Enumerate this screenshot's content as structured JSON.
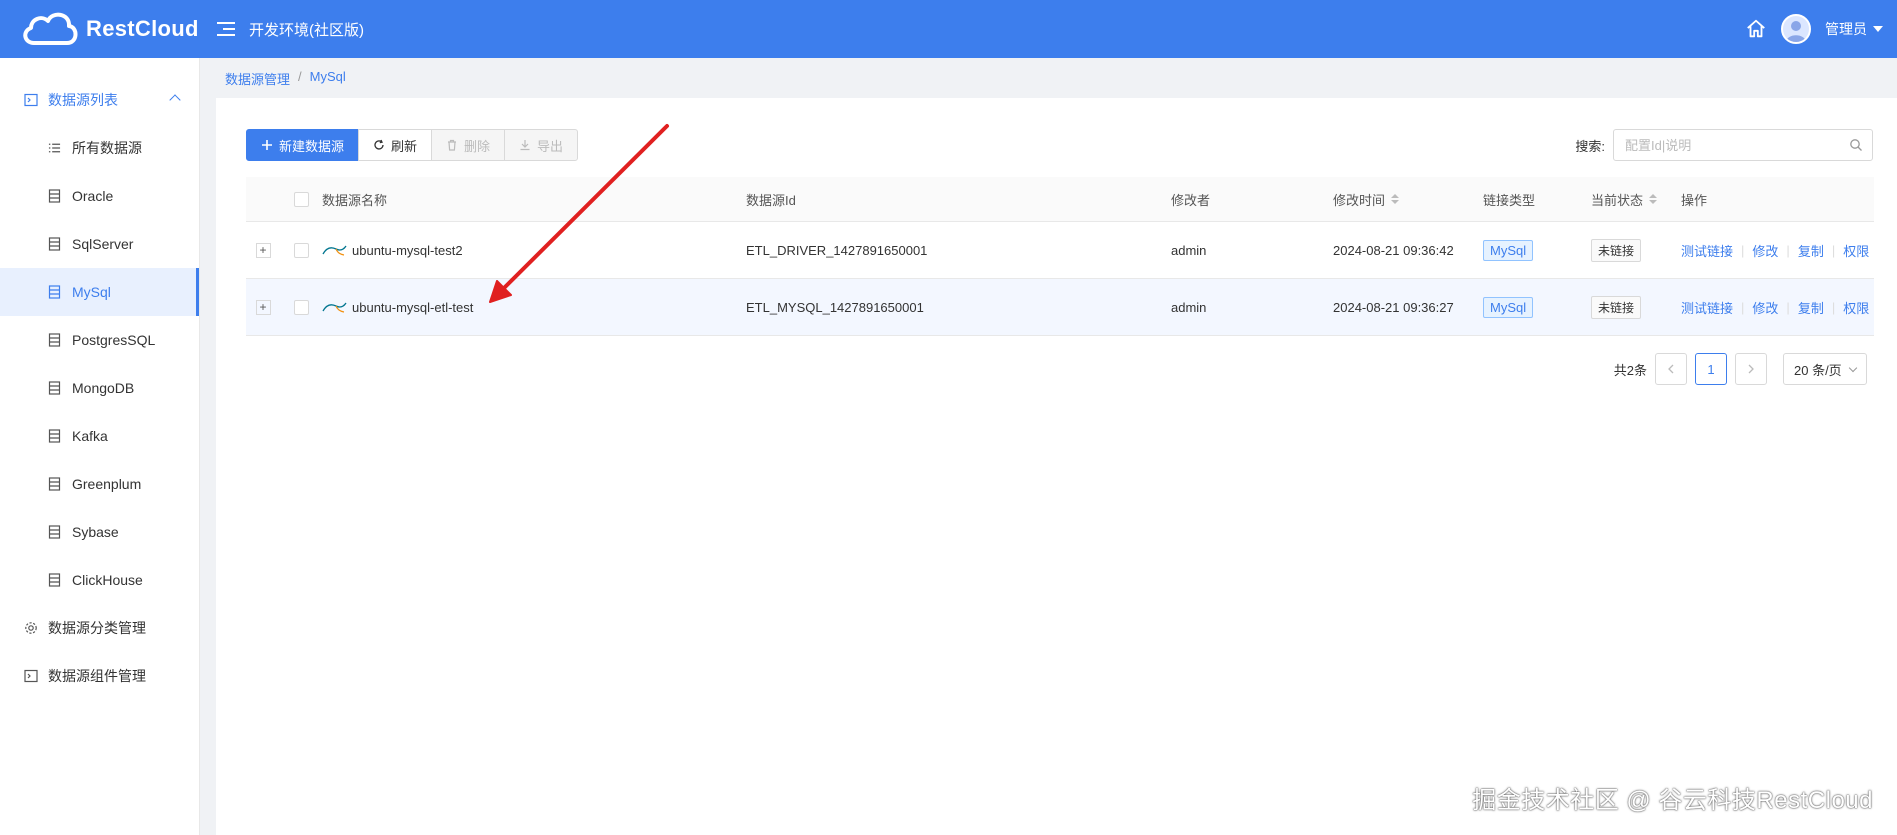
{
  "header": {
    "logo_text": "RestCloud",
    "env_title": "开发环境(社区版)",
    "user_name": "管理员"
  },
  "sidebar": {
    "group_main": "数据源列表",
    "items": [
      {
        "label": "所有数据源"
      },
      {
        "label": "Oracle"
      },
      {
        "label": "SqlServer"
      },
      {
        "label": "MySql"
      },
      {
        "label": "PostgresSQL"
      },
      {
        "label": "MongoDB"
      },
      {
        "label": "Kafka"
      },
      {
        "label": "Greenplum"
      },
      {
        "label": "Sybase"
      },
      {
        "label": "ClickHouse"
      }
    ],
    "group_category": "数据源分类管理",
    "group_component": "数据源组件管理"
  },
  "breadcrumb": {
    "parent": "数据源管理",
    "sep": "/",
    "current": "MySql"
  },
  "toolbar": {
    "new_label": "新建数据源",
    "refresh_label": "刷新",
    "delete_label": "删除",
    "export_label": "导出"
  },
  "search": {
    "label": "搜索:",
    "placeholder": "配置Id|说明"
  },
  "table": {
    "headers": {
      "name": "数据源名称",
      "id": "数据源Id",
      "modifier": "修改者",
      "time": "修改时间",
      "type": "链接类型",
      "state": "当前状态",
      "ops": "操作"
    },
    "rows": [
      {
        "name": "ubuntu-mysql-test2",
        "id": "ETL_DRIVER_1427891650001",
        "modifier": "admin",
        "time": "2024-08-21 09:36:42",
        "type": "MySql",
        "state": "未链接"
      },
      {
        "name": "ubuntu-mysql-etl-test",
        "id": "ETL_MYSQL_1427891650001",
        "modifier": "admin",
        "time": "2024-08-21 09:36:27",
        "type": "MySql",
        "state": "未链接"
      }
    ],
    "ops": {
      "test": "测试链接",
      "edit": "修改",
      "copy": "复制",
      "perm": "权限"
    }
  },
  "pagination": {
    "total": "共2条",
    "page": "1",
    "page_size": "20 条/页"
  },
  "watermark": "掘金技术社区 @ 谷云科技RestCloud",
  "colors": {
    "primary": "#3d7eed",
    "arrow": "#e02020"
  }
}
